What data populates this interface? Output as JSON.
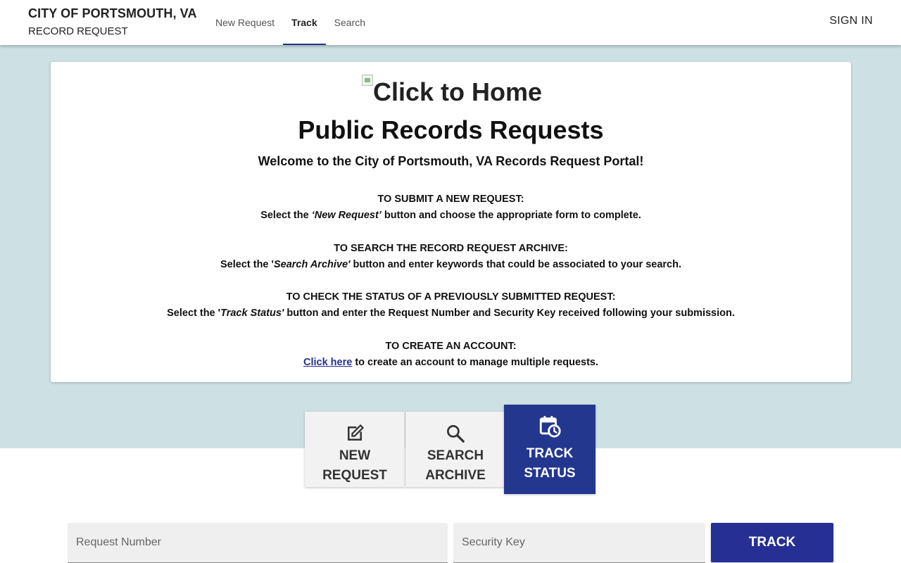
{
  "header": {
    "title": "CITY OF PORTSMOUTH, VA",
    "subtitle": "RECORD REQUEST",
    "tabs": [
      {
        "label": "New Request"
      },
      {
        "label": "Track"
      },
      {
        "label": "Search"
      }
    ],
    "active_tab": "Track",
    "sign_in": "SIGN IN"
  },
  "card": {
    "logo_alt": "Click to Home",
    "title": "Public Records Requests",
    "welcome": "Welcome to the City of Portsmouth, VA Records Request Portal!",
    "sections": [
      {
        "heading": "TO SUBMIT A NEW REQUEST:",
        "before": "Select the ",
        "emph": "‘New Request’",
        "after": " button and choose the appropriate form to complete."
      },
      {
        "heading": "TO SEARCH THE RECORD REQUEST ARCHIVE:",
        "before": "Select the '",
        "emph": "Search Archive'",
        "after": " button and enter keywords that could be associated to your search."
      },
      {
        "heading": "TO CHECK THE STATUS OF A PREVIOUSLY SUBMITTED REQUEST:",
        "before": "Select the '",
        "emph": "Track Status'",
        "after": " button and enter the Request Number and Security Key received following your submission."
      },
      {
        "heading": "TO CREATE AN ACCOUNT:",
        "link": "Click here",
        "after": " to create an account to manage multiple requests."
      }
    ]
  },
  "tiles": [
    {
      "label_1": "NEW",
      "label_2": "REQUEST",
      "icon": "edit-icon"
    },
    {
      "label_1": "SEARCH",
      "label_2": "ARCHIVE",
      "icon": "search-icon"
    },
    {
      "label_1": "TRACK",
      "label_2": "STATUS",
      "icon": "calendar-clock-icon",
      "active": true
    }
  ],
  "track_form": {
    "request_number_placeholder": "Request Number",
    "security_key_placeholder": "Security Key",
    "track_button": "TRACK"
  },
  "colors": {
    "accent": "#23308f",
    "band": "#cde0e3",
    "tile_active": "#23378f"
  }
}
